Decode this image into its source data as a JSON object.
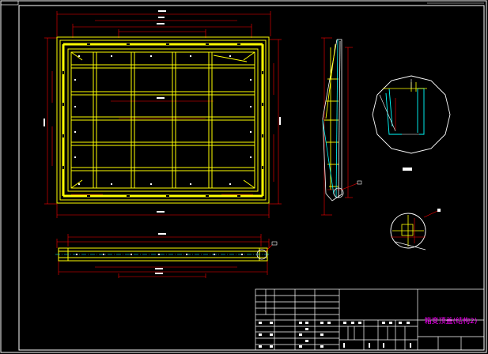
{
  "drawing": {
    "title_block": {
      "title": "箱变顶盖(结构2)"
    },
    "colors": {
      "background": "#000000",
      "frame": "#ffffff",
      "structure": "#ffff00",
      "dimension": "#ff0000",
      "detail": "#00ffff",
      "accent": "#ff00ff",
      "label": "#ffffff"
    }
  }
}
